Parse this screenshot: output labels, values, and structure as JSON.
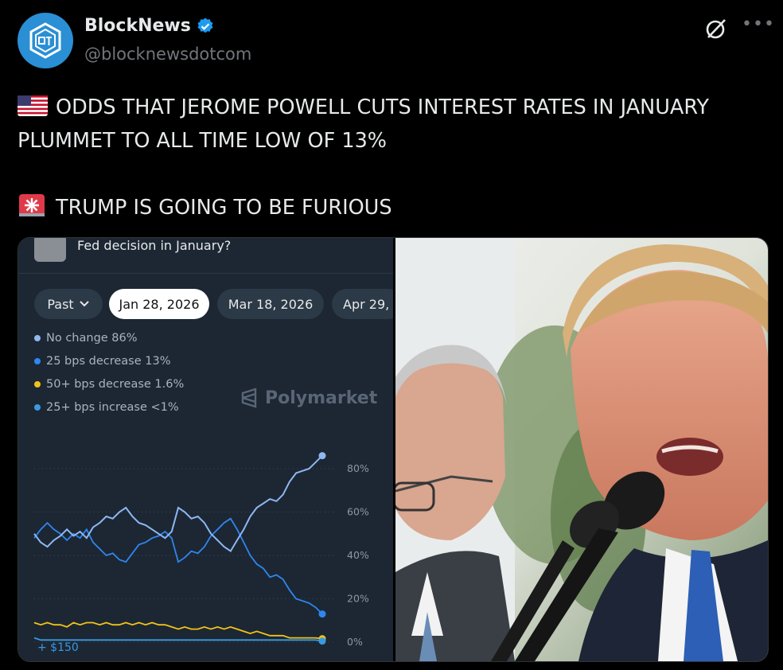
{
  "author": {
    "name": "BlockNews",
    "handle": "@blocknewsdotcom",
    "verified": true,
    "accent": "#1d9bf0"
  },
  "tweet": {
    "line1": "ODDS THAT JEROME POWELL CUTS INTEREST RATES IN JANUARY PLUMMET TO ALL TIME LOW OF 13%",
    "line2": "TRUMP IS GOING TO BE FURIOUS",
    "emoji1": "us-flag-icon",
    "emoji2": "siren-icon"
  },
  "polymarket": {
    "title": "Fed decision in January?",
    "tabs": [
      {
        "label": "Past",
        "has_chevron": true
      },
      {
        "label": "Jan 28, 2026",
        "active": true
      },
      {
        "label": "Mar 18, 2026"
      },
      {
        "label": "Apr 29,"
      }
    ],
    "watermark": "Polymarket",
    "balance": "+ $150"
  },
  "chart_data": {
    "type": "line",
    "y_ticks": [
      "80%",
      "60%",
      "40%",
      "20%",
      "0%"
    ],
    "ylim": [
      0,
      100
    ],
    "series": [
      {
        "name": "No change",
        "legend": "No change 86%",
        "color": "#8fb7f2",
        "last": 86,
        "values": [
          50,
          46,
          44,
          47,
          49,
          52,
          49,
          51,
          48,
          53,
          55,
          58,
          57,
          60,
          62,
          58,
          55,
          54,
          52,
          50,
          48,
          51,
          62,
          60,
          57,
          58,
          55,
          50,
          47,
          44,
          42,
          47,
          52,
          58,
          62,
          64,
          66,
          65,
          68,
          74,
          78,
          79,
          80,
          83,
          86
        ]
      },
      {
        "name": "25 bps decrease",
        "legend": "25 bps decrease 13%",
        "color": "#2f86f0",
        "last": 13,
        "values": [
          48,
          52,
          55,
          52,
          50,
          47,
          50,
          48,
          52,
          46,
          43,
          40,
          41,
          38,
          37,
          41,
          45,
          46,
          48,
          49,
          51,
          48,
          37,
          39,
          42,
          41,
          44,
          49,
          52,
          55,
          57,
          52,
          46,
          40,
          36,
          34,
          30,
          31,
          29,
          24,
          20,
          19,
          18,
          16,
          13
        ]
      },
      {
        "name": "50+ bps decrease",
        "legend": "50+ bps decrease 1.6%",
        "color": "#f0c31a",
        "last": 1.6,
        "values": [
          9,
          8,
          9,
          8,
          8,
          7,
          9,
          8,
          9,
          9,
          8,
          9,
          8,
          8,
          9,
          8,
          9,
          8,
          9,
          8,
          8,
          7,
          6,
          7,
          6,
          6,
          7,
          6,
          7,
          6,
          7,
          6,
          5,
          4,
          5,
          4,
          3,
          3,
          3,
          2,
          2,
          2,
          2,
          2,
          1.6
        ]
      },
      {
        "name": "25+ bps increase",
        "legend": "25+ bps increase <1%",
        "color": "#3a9ae0",
        "last": 0.5,
        "values": [
          2,
          1,
          1,
          1,
          1,
          1,
          1,
          1,
          1,
          1,
          1,
          1,
          1,
          1,
          1,
          1,
          1,
          1,
          1,
          1,
          1,
          1,
          1,
          1,
          1,
          1,
          1,
          1,
          1,
          1,
          1,
          1,
          1,
          1,
          1,
          1,
          1,
          1,
          1,
          1,
          1,
          1,
          1,
          1,
          0.5
        ]
      }
    ]
  },
  "photo": {
    "subject": "Jerome Powell and Donald Trump at podium microphone"
  }
}
